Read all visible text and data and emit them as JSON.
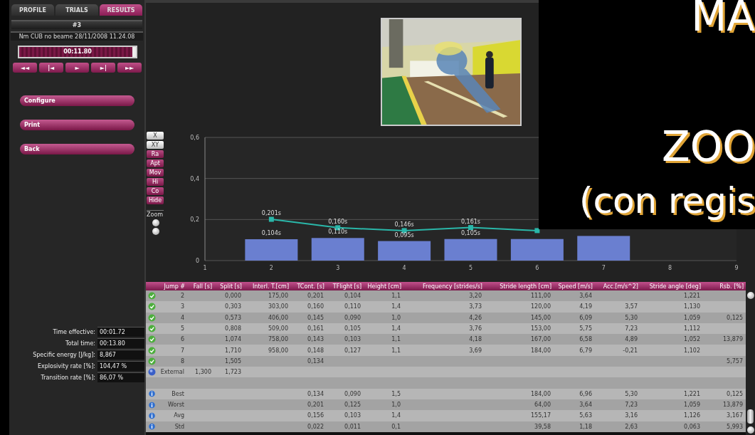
{
  "tabs": [
    {
      "label": "PROFILE",
      "selected": false
    },
    {
      "label": "TRIALS",
      "selected": false
    },
    {
      "label": "RESULTS",
      "selected": true
    }
  ],
  "trial_header": "#3",
  "trial_info": "Nm CUB no beame 28/11/2008 11.24.08",
  "timeline": {
    "time": "00:11.80",
    "level": 0.97
  },
  "transport": [
    "◄◄",
    "|◄",
    "►",
    "►|",
    "►►"
  ],
  "actions": [
    "Configure",
    "Print",
    "Back"
  ],
  "stats": [
    {
      "label": "Time effective:",
      "value": "00:01.72"
    },
    {
      "label": "Total time:",
      "value": "00:13.80"
    },
    {
      "label": "Specific energy [J/kg]:",
      "value": "8,867"
    },
    {
      "label": "Explosivity rate [%]:",
      "value": "104,47 %"
    },
    {
      "label": "Transition rate [%]:",
      "value": "86,07 %"
    }
  ],
  "chart_tools": [
    {
      "label": "X",
      "kind": "light"
    },
    {
      "label": "XY",
      "kind": "light"
    },
    {
      "label": "Ra",
      "kind": "pink"
    },
    {
      "label": "Apt",
      "kind": "pink"
    },
    {
      "label": "Mov",
      "kind": "pink"
    },
    {
      "label": "Hi",
      "kind": "pink"
    },
    {
      "label": "Co",
      "kind": "pink"
    },
    {
      "label": "Hide",
      "kind": "pink"
    }
  ],
  "zoom": {
    "label": "Zoom",
    "options": [
      {
        "selected": false
      },
      {
        "selected": false
      }
    ]
  },
  "chart_data": {
    "type": "bar",
    "x": [
      "1",
      "2",
      "3",
      "4",
      "5",
      "6",
      "7",
      "8",
      "9"
    ],
    "ylim": [
      0,
      0.6
    ],
    "yticks": [
      {
        "value": 0,
        "label": "0"
      },
      {
        "value": 0.2,
        "label": "0,2"
      },
      {
        "value": 0.4,
        "label": "0,4"
      },
      {
        "value": 0.6,
        "label": "0,6"
      }
    ],
    "series": [
      {
        "type": "bar",
        "color": "#6a7fd0",
        "values": [
          null,
          0.104,
          0.11,
          0.095,
          0.105,
          0.105,
          0.12,
          null,
          null
        ]
      },
      {
        "type": "line",
        "color": "#2ab7a9",
        "marker": "square",
        "values": [
          null,
          0.201,
          0.16,
          0.146,
          0.161,
          0.146,
          null,
          null,
          null
        ]
      }
    ],
    "annotations": [
      {
        "x": "2",
        "y": 0.201,
        "text": "0,201s"
      },
      {
        "x": "3",
        "y": 0.16,
        "text": "0,160s"
      },
      {
        "x": "4",
        "y": 0.146,
        "text": "0,146s"
      },
      {
        "x": "5",
        "y": 0.161,
        "text": "0,161s"
      },
      {
        "x": "2",
        "y": 0.104,
        "text": "0,104s"
      },
      {
        "x": "3",
        "y": 0.11,
        "text": "0,110s"
      },
      {
        "x": "4",
        "y": 0.095,
        "text": "0,095s"
      },
      {
        "x": "5",
        "y": 0.105,
        "text": "0,105s"
      }
    ]
  },
  "table": {
    "columns": [
      "Jump #",
      "Fall [s]",
      "Split [s]",
      "Interl. T.[cm]",
      "TCont. [s]",
      "TFlight [s]",
      "Height [cm]",
      "Frequency [strides/s]",
      "Stride length [cm]",
      "Speed [m/s]",
      "Acc.[m/s^2]",
      "Stride angle [deg]",
      "Rsb. [%]"
    ],
    "rows": [
      {
        "kind": "trial",
        "cells": [
          "2",
          "",
          "0,000",
          "175,00",
          "0,201",
          "0,104",
          "1,1",
          "3,20",
          "111,00",
          "3,64",
          "",
          "1,221",
          ""
        ]
      },
      {
        "kind": "trial",
        "cells": [
          "3",
          "",
          "0,303",
          "303,00",
          "0,160",
          "0,110",
          "1,4",
          "3,73",
          "120,00",
          "4,19",
          "3,57",
          "1,130",
          ""
        ]
      },
      {
        "kind": "trial",
        "cells": [
          "4",
          "",
          "0,573",
          "406,00",
          "0,145",
          "0,090",
          "1,0",
          "4,26",
          "145,00",
          "6,09",
          "5,30",
          "1,059",
          "0,125"
        ]
      },
      {
        "kind": "trial",
        "cells": [
          "5",
          "",
          "0,808",
          "509,00",
          "0,161",
          "0,105",
          "1,4",
          "3,76",
          "153,00",
          "5,75",
          "7,23",
          "1,112",
          ""
        ]
      },
      {
        "kind": "trial",
        "cells": [
          "6",
          "",
          "1,074",
          "758,00",
          "0,143",
          "0,103",
          "1,1",
          "4,18",
          "167,00",
          "6,58",
          "4,89",
          "1,052",
          "13,879"
        ]
      },
      {
        "kind": "trial",
        "cells": [
          "7",
          "",
          "1,710",
          "958,00",
          "0,148",
          "0,127",
          "1,1",
          "3,69",
          "184,00",
          "6,79",
          "-0,21",
          "1,102",
          ""
        ]
      },
      {
        "kind": "trial",
        "cells": [
          "8",
          "",
          "1,505",
          "",
          "0,134",
          "",
          "",
          "",
          "",
          "",
          "",
          "",
          "5,757"
        ]
      },
      {
        "kind": "external",
        "cells": [
          "External",
          "1,300",
          "1,723",
          "",
          "",
          "",
          "",
          "",
          "",
          "",
          "",
          "",
          ""
        ]
      },
      {
        "kind": "spacer",
        "cells": [
          "",
          "",
          "",
          "",
          "",
          "",
          "",
          "",
          "",
          "",
          "",
          "",
          ""
        ]
      },
      {
        "kind": "summary",
        "cells": [
          "Best",
          "",
          "",
          "",
          "0,134",
          "0,090",
          "1,5",
          "",
          "184,00",
          "6,96",
          "5,30",
          "1,221",
          "0,125"
        ]
      },
      {
        "kind": "summary",
        "cells": [
          "Worst",
          "",
          "",
          "",
          "0,201",
          "0,125",
          "1,0",
          "",
          "64,00",
          "3,64",
          "7,23",
          "1,059",
          "13,879"
        ]
      },
      {
        "kind": "summary",
        "cells": [
          "Avg",
          "",
          "",
          "",
          "0,156",
          "0,103",
          "1,4",
          "",
          "155,17",
          "5,63",
          "3,16",
          "1,126",
          "3,167"
        ]
      },
      {
        "kind": "summary",
        "cells": [
          "Std",
          "",
          "",
          "",
          "0,022",
          "0,011",
          "0,1",
          "",
          "39,58",
          "1,18",
          "2,63",
          "0,063",
          "5,993"
        ]
      }
    ]
  },
  "overlay": {
    "lines": [
      "MA",
      "ZOO",
      "(con regis"
    ]
  }
}
